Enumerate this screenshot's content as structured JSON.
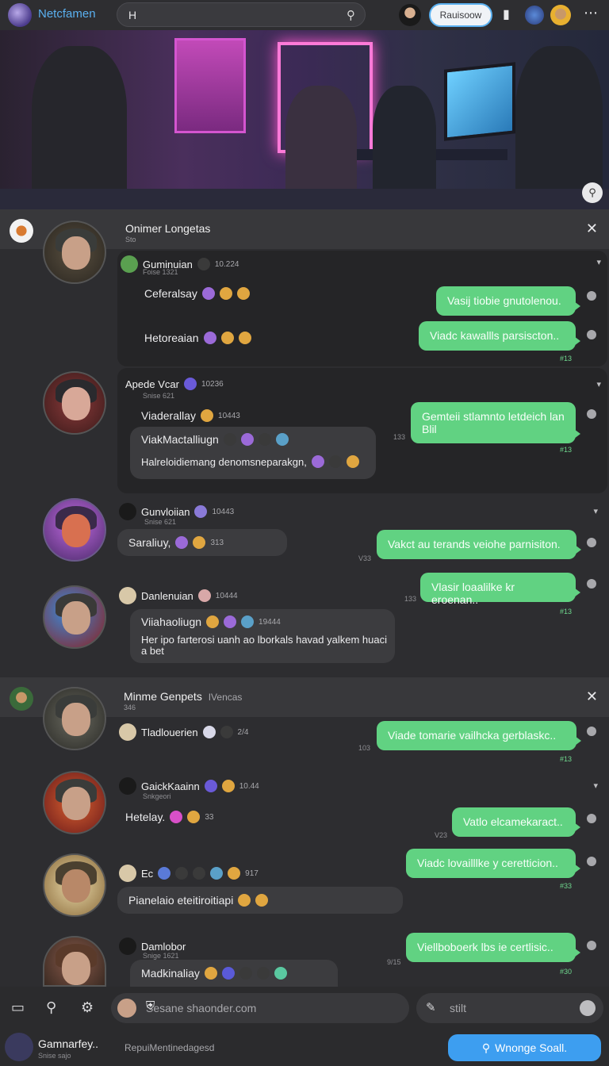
{
  "app": {
    "name": "Netcfamen"
  },
  "search": {
    "value": "H"
  },
  "nav": {
    "pill_label": "Rauisoow"
  },
  "panel1": {
    "title": "Onimer Longetas",
    "subtitle": "Sto",
    "threads": [
      {
        "user": "Guminuian",
        "time": "10.224",
        "sub": "Foise 1321",
        "lines": [
          "Ceferalsay",
          "Hetoreaian"
        ],
        "out": [
          {
            "text": "Vasij tiobie gnutolenou.",
            "meta": ""
          },
          {
            "text": "Viadc kawallls parsiscton..",
            "meta": "#13"
          }
        ]
      },
      {
        "user": "Apede Vcar",
        "time": "10236",
        "sub": "Snise 621",
        "lines": [
          "Viaderallay",
          "ViakMactalliugn",
          "Halreloidiemang denomsneparakgn,"
        ],
        "line_time": "10443",
        "out": [
          {
            "text": "Gemteii stlamnto letdeich lan Blil",
            "meta": "#13"
          }
        ],
        "ts": "133"
      },
      {
        "user": "Gunvloiian",
        "time": "10443",
        "sub": "Snise 621",
        "in_bubble": "Saraliuy,",
        "in_time": "313",
        "out": [
          {
            "text": "Vakct au terands veiohe parnisiton.",
            "meta": ""
          }
        ],
        "ts": "V33"
      },
      {
        "user": "Danlenuian",
        "time": "10444",
        "sub": "",
        "lines": [
          "Viiahaoliugn"
        ],
        "line_time": "19444",
        "in_bubble": "Her ipo farterosi uanh ao lborkals havad yalkem huaci a bet",
        "out": [
          {
            "text": "Vlasir loaalilke kr eroenan..",
            "meta": "#13"
          }
        ],
        "ts": "133"
      }
    ]
  },
  "panel2": {
    "title": "Minme Genpets",
    "title_suffix": "IVencas",
    "subtitle": "346",
    "threads": [
      {
        "user": "Tladlouerien",
        "time": "2/4",
        "out": [
          {
            "text": "Viade tomarie vailhcka gerblaskc..",
            "meta": "#13"
          }
        ],
        "ts": "103"
      },
      {
        "user": "GaickKaainn",
        "time": "10.44",
        "sub": "Snkgeori",
        "line": "Hetelay.",
        "line_time": "33",
        "out": [
          {
            "text": "Vatlo elcamekaract..",
            "meta": ""
          }
        ],
        "ts": "V23"
      },
      {
        "user": "Ec",
        "time": "917",
        "in_bubble": "Pianelaio eteitiroitiapi",
        "out": [
          {
            "text": "Viadc lovailllke y ceretticion..",
            "meta": "#33"
          }
        ]
      },
      {
        "user": "Damlobor",
        "sub": "Snige 1621",
        "line": "Madkinaliay",
        "out": [
          {
            "text": "Viellboboerk lbs ie certlisic..",
            "meta": "#30"
          }
        ],
        "ts": "9/15"
      }
    ]
  },
  "composer": {
    "placeholder": "Sesane shaonder.com",
    "secondary": "stilt"
  },
  "footer": {
    "name": "Gamnarfey..",
    "sub": "Snise sajo",
    "mid": "RepuiMentinedagesd",
    "button": "Wnonge Soall."
  },
  "colors": {
    "accent": "#3d9ef0",
    "outgoing": "#61d282",
    "bg": "#2b2b2d"
  }
}
